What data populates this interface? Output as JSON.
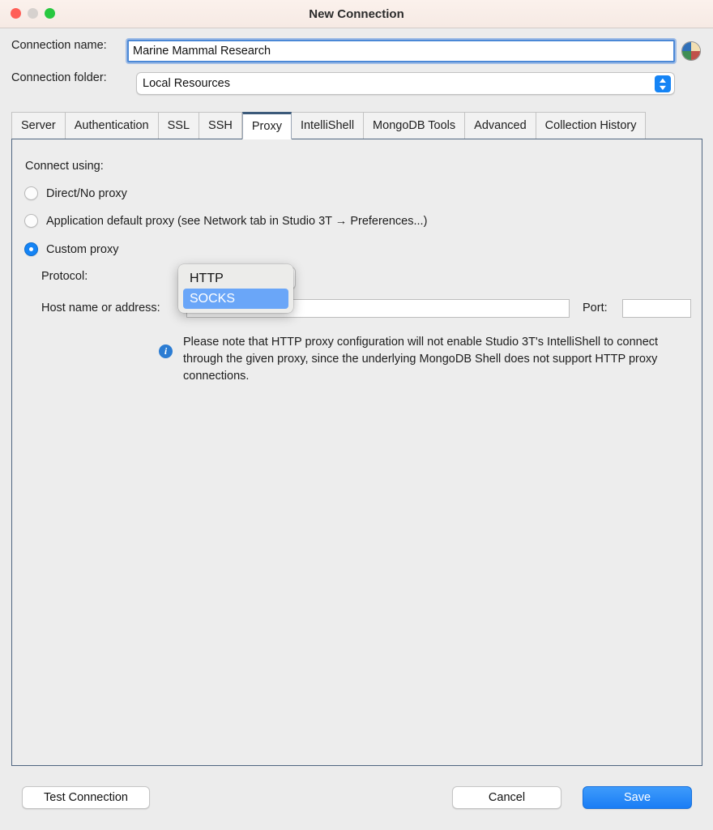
{
  "window": {
    "title": "New Connection",
    "traffic_lights": [
      "close",
      "minimize",
      "maximize"
    ]
  },
  "form": {
    "connection_name_label": "Connection name:",
    "connection_name_value": "Marine Mammal Research",
    "connection_name_placeholder": "",
    "connection_folder_label": "Connection folder:",
    "connection_folder_value": "Local Resources"
  },
  "tabs": [
    {
      "label": "Server",
      "active": false
    },
    {
      "label": "Authentication",
      "active": false
    },
    {
      "label": "SSL",
      "active": false
    },
    {
      "label": "SSH",
      "active": false
    },
    {
      "label": "Proxy",
      "active": true
    },
    {
      "label": "IntelliShell",
      "active": false
    },
    {
      "label": "MongoDB Tools",
      "active": false
    },
    {
      "label": "Advanced",
      "active": false
    },
    {
      "label": "Collection History",
      "active": false
    }
  ],
  "proxy_panel": {
    "connect_using_label": "Connect using:",
    "options": [
      {
        "label": "Direct/No proxy",
        "selected": false
      },
      {
        "label": "Application default proxy (see Network tab in Studio 3T → Preferences...)",
        "selected": false
      },
      {
        "label": "Custom proxy",
        "selected": true
      }
    ],
    "protocol_label": "Protocol:",
    "protocol_value": "SOCKS",
    "host_label": "Host name or address:",
    "host_value": "",
    "port_label": "Port:",
    "port_value": "",
    "info_text": "Please note that HTTP proxy configuration will not enable Studio 3T's IntelliShell to connect through the given proxy, since the underlying MongoDB Shell does not support HTTP proxy connections."
  },
  "protocol_menu": {
    "open": true,
    "items": [
      {
        "label": "HTTP",
        "selected": false
      },
      {
        "label": "SOCKS",
        "selected": true
      }
    ]
  },
  "footer": {
    "test_connection_label": "Test Connection",
    "cancel_label": "Cancel",
    "save_label": "Save"
  },
  "colors": {
    "accent": "#1584f5",
    "popup_selection": "#6aa6f8",
    "panel_border": "#4f6580",
    "active_tab_indicator": "#3c5a7a",
    "info_icon": "#2b7cd3",
    "traffic_close": "#ff5f57",
    "traffic_min": "#d6d1ce",
    "traffic_max": "#28c840"
  }
}
